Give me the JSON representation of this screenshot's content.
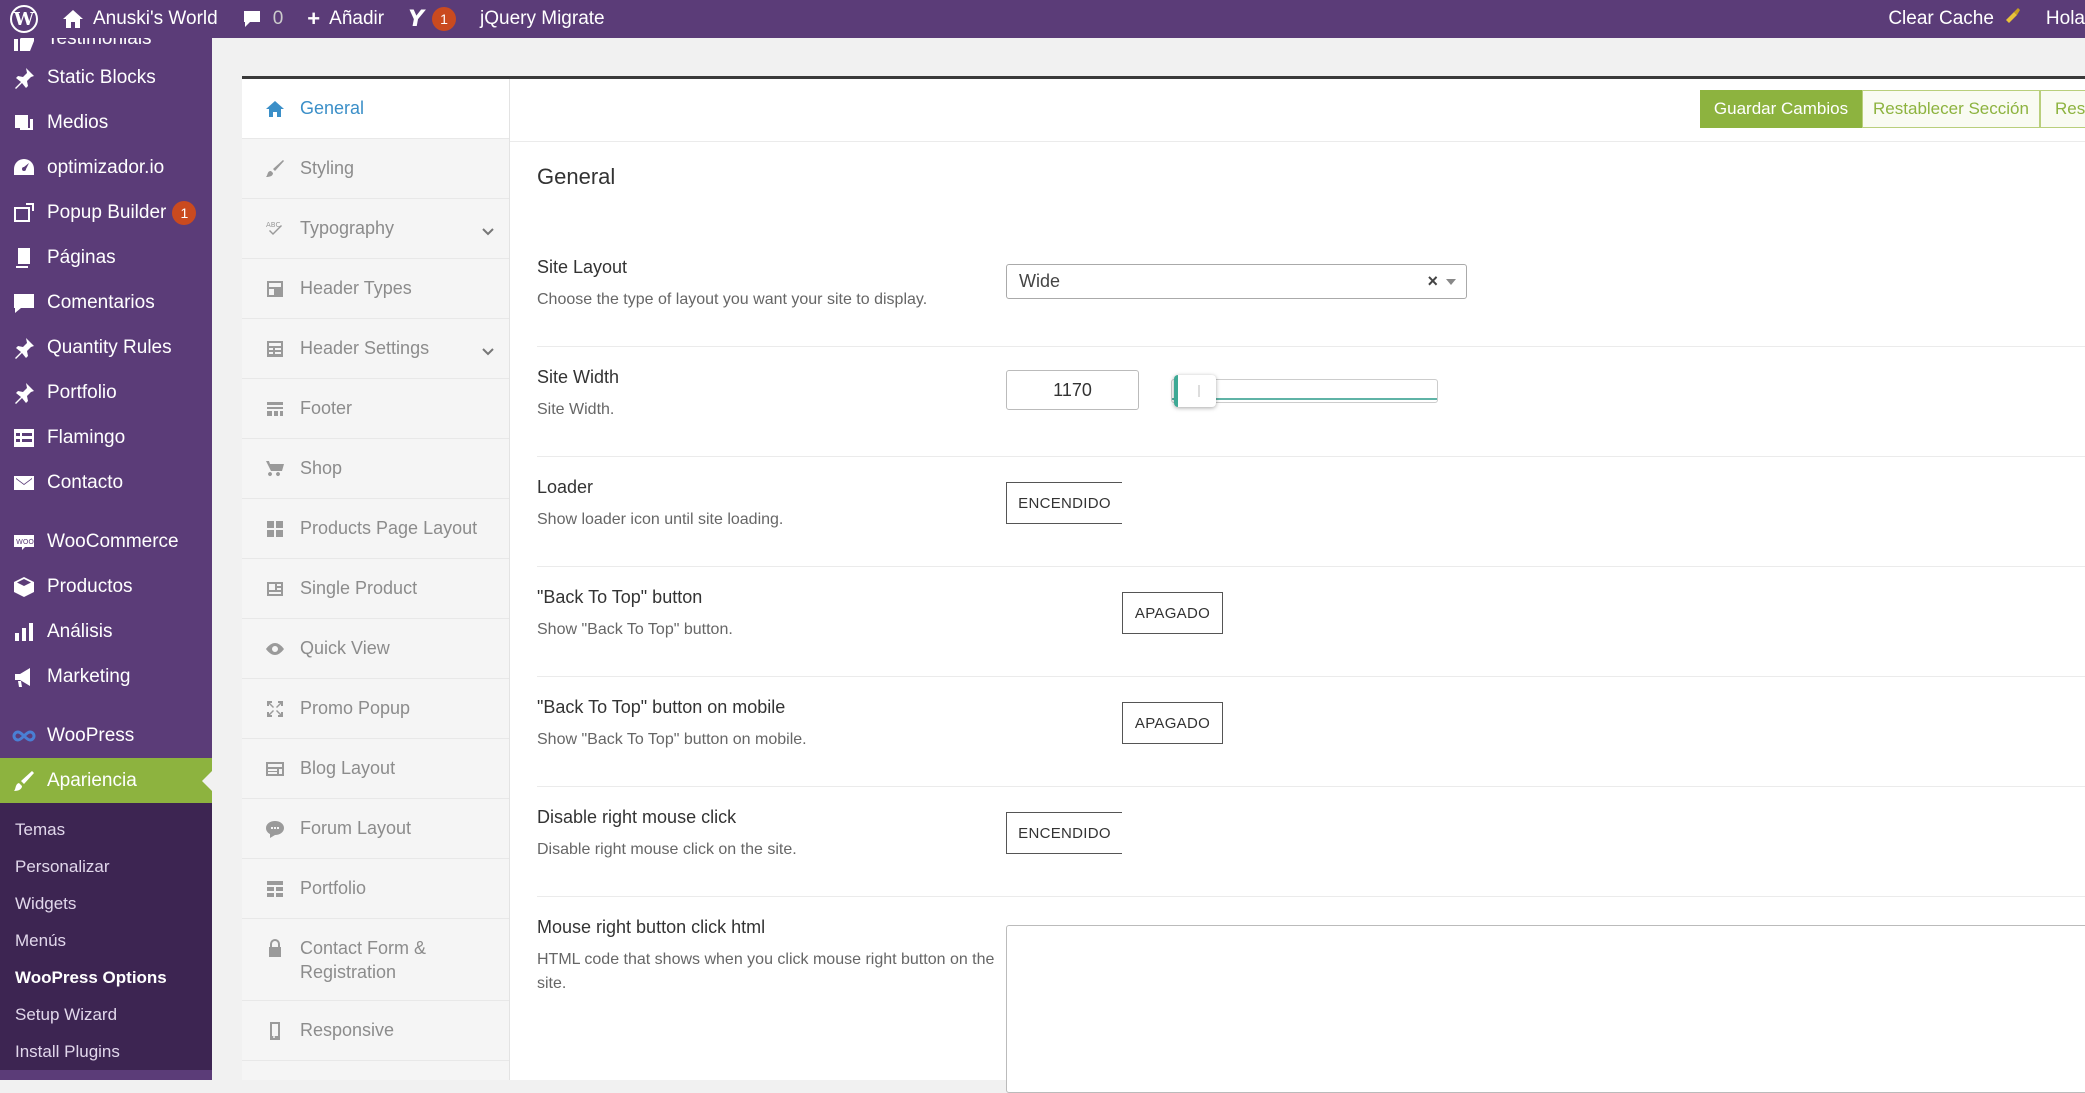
{
  "adminbar": {
    "site_name": "Anuski's World",
    "comments_count": "0",
    "add_label": "Añadir",
    "yoast_count": "1",
    "jquery_migrate": "jQuery Migrate",
    "clear_cache": "Clear Cache",
    "greeting": "Hola"
  },
  "menu": {
    "items": [
      {
        "label": "Testimonials",
        "icon": "thumbs-up-icon"
      },
      {
        "label": "Static Blocks",
        "icon": "pin-icon"
      },
      {
        "label": "Medios",
        "icon": "media-icon"
      },
      {
        "label": "optimizador.io",
        "icon": "gauge-icon"
      },
      {
        "label": "Popup Builder",
        "icon": "popup-icon",
        "badge": "1"
      },
      {
        "label": "Páginas",
        "icon": "pages-icon"
      },
      {
        "label": "Comentarios",
        "icon": "comment-icon"
      },
      {
        "label": "Quantity Rules",
        "icon": "pin-icon"
      },
      {
        "label": "Portfolio",
        "icon": "pin-icon"
      },
      {
        "label": "Flamingo",
        "icon": "list-icon"
      },
      {
        "label": "Contacto",
        "icon": "mail-icon"
      },
      {
        "label": "WooCommerce",
        "icon": "woo-icon"
      },
      {
        "label": "Productos",
        "icon": "box-icon"
      },
      {
        "label": "Análisis",
        "icon": "bar-chart-icon"
      },
      {
        "label": "Marketing",
        "icon": "megaphone-icon"
      },
      {
        "label": "WooPress",
        "icon": "infinity-icon"
      },
      {
        "label": "Apariencia",
        "icon": "brush-icon"
      }
    ],
    "submenu": [
      "Temas",
      "Personalizar",
      "Widgets",
      "Menús",
      "WooPress Options",
      "Setup Wizard",
      "Install Plugins"
    ]
  },
  "tabs": [
    {
      "label": "General",
      "icon": "home-icon"
    },
    {
      "label": "Styling",
      "icon": "brush-icon"
    },
    {
      "label": "Typography",
      "icon": "typography-icon"
    },
    {
      "label": "Header Types",
      "icon": "header-types-icon"
    },
    {
      "label": "Header Settings",
      "icon": "header-settings-icon"
    },
    {
      "label": "Footer",
      "icon": "footer-icon"
    },
    {
      "label": "Shop",
      "icon": "cart-icon"
    },
    {
      "label": "Products Page Layout",
      "icon": "grid-icon"
    },
    {
      "label": "Single Product",
      "icon": "single-product-icon"
    },
    {
      "label": "Quick View",
      "icon": "eye-icon"
    },
    {
      "label": "Promo Popup",
      "icon": "expand-icon"
    },
    {
      "label": "Blog Layout",
      "icon": "blog-icon"
    },
    {
      "label": "Forum Layout",
      "icon": "forum-icon"
    },
    {
      "label": "Portfolio",
      "icon": "portfolio-icon"
    },
    {
      "label": "Contact Form & Registration",
      "icon": "lock-icon"
    },
    {
      "label": "Responsive",
      "icon": "mobile-icon"
    }
  ],
  "toolbar": {
    "save": "Guardar Cambios",
    "reset_section": "Restablecer Sección",
    "reset_all": "Rest"
  },
  "section": {
    "title": "General",
    "site_layout": {
      "label": "Site Layout",
      "desc": "Choose the type of layout you want your site to display.",
      "value": "Wide"
    },
    "site_width": {
      "label": "Site Width",
      "desc": "Site Width.",
      "value": "1170"
    },
    "loader": {
      "label": "Loader",
      "desc": "Show loader icon until site loading.",
      "state": "ENCENDIDO"
    },
    "back_to_top": {
      "label": "\"Back To Top\" button",
      "desc": "Show \"Back To Top\" button.",
      "state": "APAGADO"
    },
    "back_to_top_mobile": {
      "label": "\"Back To Top\" button on mobile",
      "desc": "Show \"Back To Top\" button on mobile.",
      "state": "APAGADO"
    },
    "disable_right_click": {
      "label": "Disable right mouse click",
      "desc": "Disable right mouse click on the site.",
      "state": "ENCENDIDO"
    },
    "right_click_html": {
      "label": "Mouse right button click html",
      "desc": "HTML code that shows when you click mouse right button on the site.",
      "value": ""
    }
  },
  "colors": {
    "adminbar": "#5b3c78",
    "accent": "#8db33f",
    "active_tab": "#3b8fc8",
    "badge": "#ca4a1f"
  }
}
